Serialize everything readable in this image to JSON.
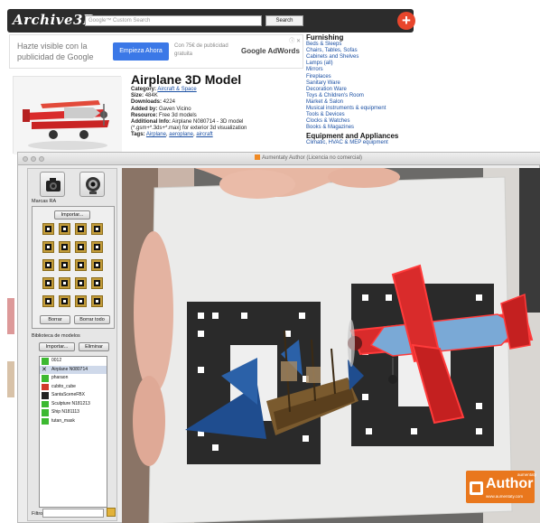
{
  "website": {
    "logo": "Archive3D",
    "search_placeholder": "Google™ Custom Search",
    "search_button": "Search",
    "plus_glyph": "+",
    "ad": {
      "text": "Hazte visible con la publicidad de Google",
      "button": "Empieza Ahora",
      "subtext": "Con 75€ de publicidad gratuita",
      "brand": "Google AdWords",
      "corner": "ⓘ ✕"
    },
    "model": {
      "title": "Airplane 3D Model",
      "category_label": "Category:",
      "category_value": "Aircraft & Space",
      "size_label": "Size:",
      "size_value": "484K",
      "downloads_label": "Downloads:",
      "downloads_value": "4224",
      "added_label": "Added by:",
      "added_value": "Gaven Vicino",
      "resource_label": "Resource:",
      "resource_value": "Free 3d models",
      "additional_label": "Additional Info:",
      "additional_value": "Airplane N080714 - 3D model (*.gsm+*.3ds+*.max) for exterior 3d visualization",
      "tags_label": "Tags:",
      "tags": [
        "Airplane",
        "aeroplane",
        "aircraft"
      ]
    },
    "categories": {
      "heading1": "Furnishing",
      "links": [
        "Beds & Sleeps",
        "Chairs, Tables, Sofas",
        "Cabinets and Shelves",
        "Lamps (all)",
        "Mirrors",
        "Fireplaces",
        "Sanitary Ware",
        "Decoration Ware",
        "Toys & Children's Room",
        "Market & Salon",
        "Musical instruments & equipment",
        "Tools & Devices",
        "Clocks & Watches",
        "Books & Magazines"
      ],
      "heading2": "Equipment and Appliances",
      "links2": [
        "Climatic, HVAC & MEP equipment"
      ]
    }
  },
  "app": {
    "window_title": "Aumentaty Author (Licencia no comercial)",
    "left_panel": {
      "camera_label": "Marcas RA",
      "import_button": "Importar...",
      "delete_button": "Borrar",
      "delete_all_button": "Borrar todo",
      "library_title": "Biblioteca de modelos",
      "library_import_button": "Importar...",
      "library_delete_button": "Eliminar",
      "models": [
        {
          "name": "0012",
          "icon": "green-check"
        },
        {
          "name": "Airplane N080714",
          "icon": "x-mark"
        },
        {
          "name": "pharaon",
          "icon": "green-check"
        },
        {
          "name": "cubito_cube",
          "icon": "red-check"
        },
        {
          "name": "SantaSceneFBX",
          "icon": "black-check"
        },
        {
          "name": "Sculpture N181213",
          "icon": "green-check"
        },
        {
          "name": "Ship N181113",
          "icon": "green-check"
        },
        {
          "name": "tutan_mask",
          "icon": "green-check"
        }
      ],
      "filter_label": "Filtro:"
    },
    "brand": {
      "small": "aumentaty",
      "name": "Author",
      "url": "www.aumentaty.com"
    }
  },
  "colors": {
    "brand_orange": "#e9771d",
    "plane_red": "#d92b2b",
    "plane_blue": "#7aa9d6",
    "list_check_green": "#3cb931"
  }
}
